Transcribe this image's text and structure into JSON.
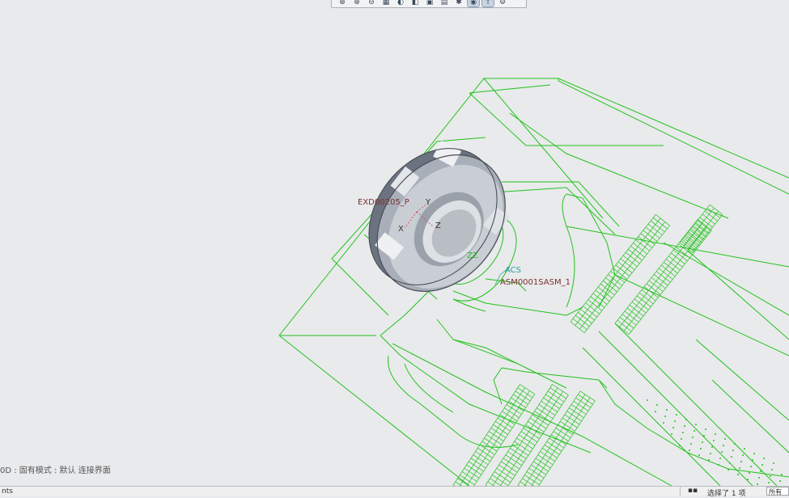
{
  "toolbar": {
    "buttons": [
      {
        "name": "zoom-window-icon",
        "glyph": "⊕"
      },
      {
        "name": "zoom-in-icon",
        "glyph": "⊕"
      },
      {
        "name": "zoom-out-icon",
        "glyph": "⊖"
      },
      {
        "name": "repaint-icon",
        "glyph": "▦"
      },
      {
        "name": "saved-views-icon",
        "glyph": "◐"
      },
      {
        "name": "display-style-icon",
        "glyph": "◧"
      },
      {
        "name": "view-manager-icon",
        "glyph": "▣"
      },
      {
        "name": "datum-display-icon",
        "glyph": "▤"
      },
      {
        "name": "spin-center-icon",
        "glyph": "✱"
      },
      {
        "name": "annotation-display-icon",
        "glyph": "◉"
      },
      {
        "name": "csys-display-icon",
        "glyph": "↑"
      },
      {
        "name": "extra-tool-icon",
        "glyph": "⚙"
      }
    ]
  },
  "scene": {
    "wire_color": "#22c21c",
    "csys_color": "#2aa0a0",
    "label_color": "#7a3030",
    "labels": {
      "part_csys": "EXD00205_P",
      "csys_y": "Y",
      "csys_x": "X",
      "csys_z": "Z",
      "asm_csys": "ACS",
      "asm_name": "ASM0001SASM_1",
      "z_marker": "ZZ"
    }
  },
  "status": {
    "mode_text": "0D : 固有模式 : 默认 连接界面",
    "bottom_message": "nts",
    "selection_text": "选择了 1 项",
    "filter_text": "所有"
  }
}
